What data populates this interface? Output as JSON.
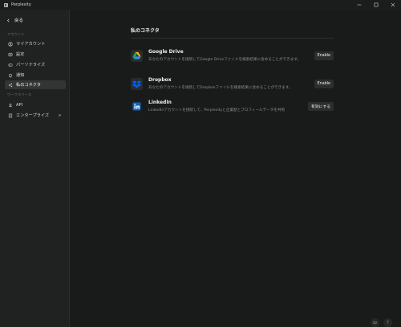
{
  "window": {
    "title": "Perplexity"
  },
  "sidebar": {
    "back_label": "戻る",
    "account_section": "アカウント",
    "workspace_section": "ワークスペース",
    "items": [
      {
        "label": "マイアカウント",
        "icon": "user-circle-icon"
      },
      {
        "label": "設定",
        "icon": "gear-icon"
      },
      {
        "label": "パーソナライズ",
        "icon": "personalize-icon"
      },
      {
        "label": "通知",
        "icon": "bell-icon"
      },
      {
        "label": "私のコネクタ",
        "icon": "connector-icon",
        "active": true
      }
    ],
    "workspace_items": [
      {
        "label": "API",
        "icon": "api-icon"
      },
      {
        "label": "エンタープライズ",
        "icon": "building-icon",
        "external": true
      }
    ]
  },
  "main": {
    "title": "私のコネクタ",
    "connectors": [
      {
        "name": "Google Drive",
        "description": "あなたのアカウントを接続してGoogle Driveファイルを検索結果に含めることができます。",
        "button": "Enable",
        "icon": "google-drive-icon"
      },
      {
        "name": "Dropbox",
        "description": "あなたのアカウントを接続してDropboxファイルを検索結果に含めることができます。",
        "button": "Enable",
        "icon": "dropbox-icon"
      },
      {
        "name": "LinkedIn",
        "description": "LinkedInアカウントを接続して、Perplexityと企業歴とプロフィールデータを共有",
        "button": "有効にする",
        "icon": "linkedin-icon"
      }
    ]
  },
  "footer": {
    "help_label": "?"
  }
}
